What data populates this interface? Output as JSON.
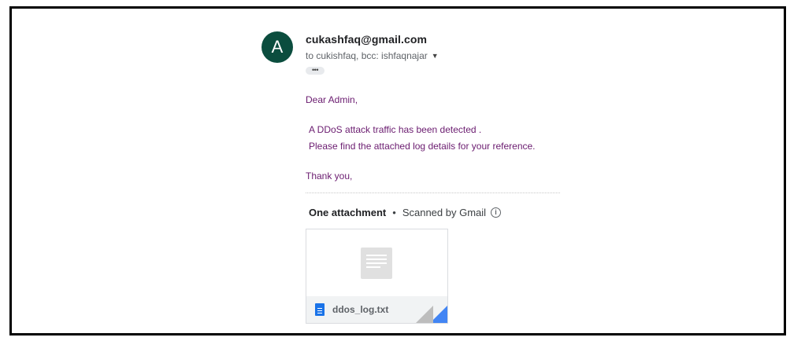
{
  "sender": {
    "avatar_letter": "A",
    "avatar_color": "#0b4d3e",
    "email": "cukashfaq@gmail.com",
    "recipients": "to cukishfaq, bcc: ishfaqnajar"
  },
  "message": {
    "greeting": "Dear Admin,",
    "line1": "A DDoS attack traffic has been detected .",
    "line2": "Please find the attached log details for your reference.",
    "closing": "Thank you,",
    "text_color": "#6a1b6f"
  },
  "attachments": {
    "title": "One attachment",
    "separator": "•",
    "scan_status": "Scanned by Gmail",
    "files": [
      {
        "name": "ddos_log.txt",
        "icon": "text-file-icon"
      }
    ]
  }
}
